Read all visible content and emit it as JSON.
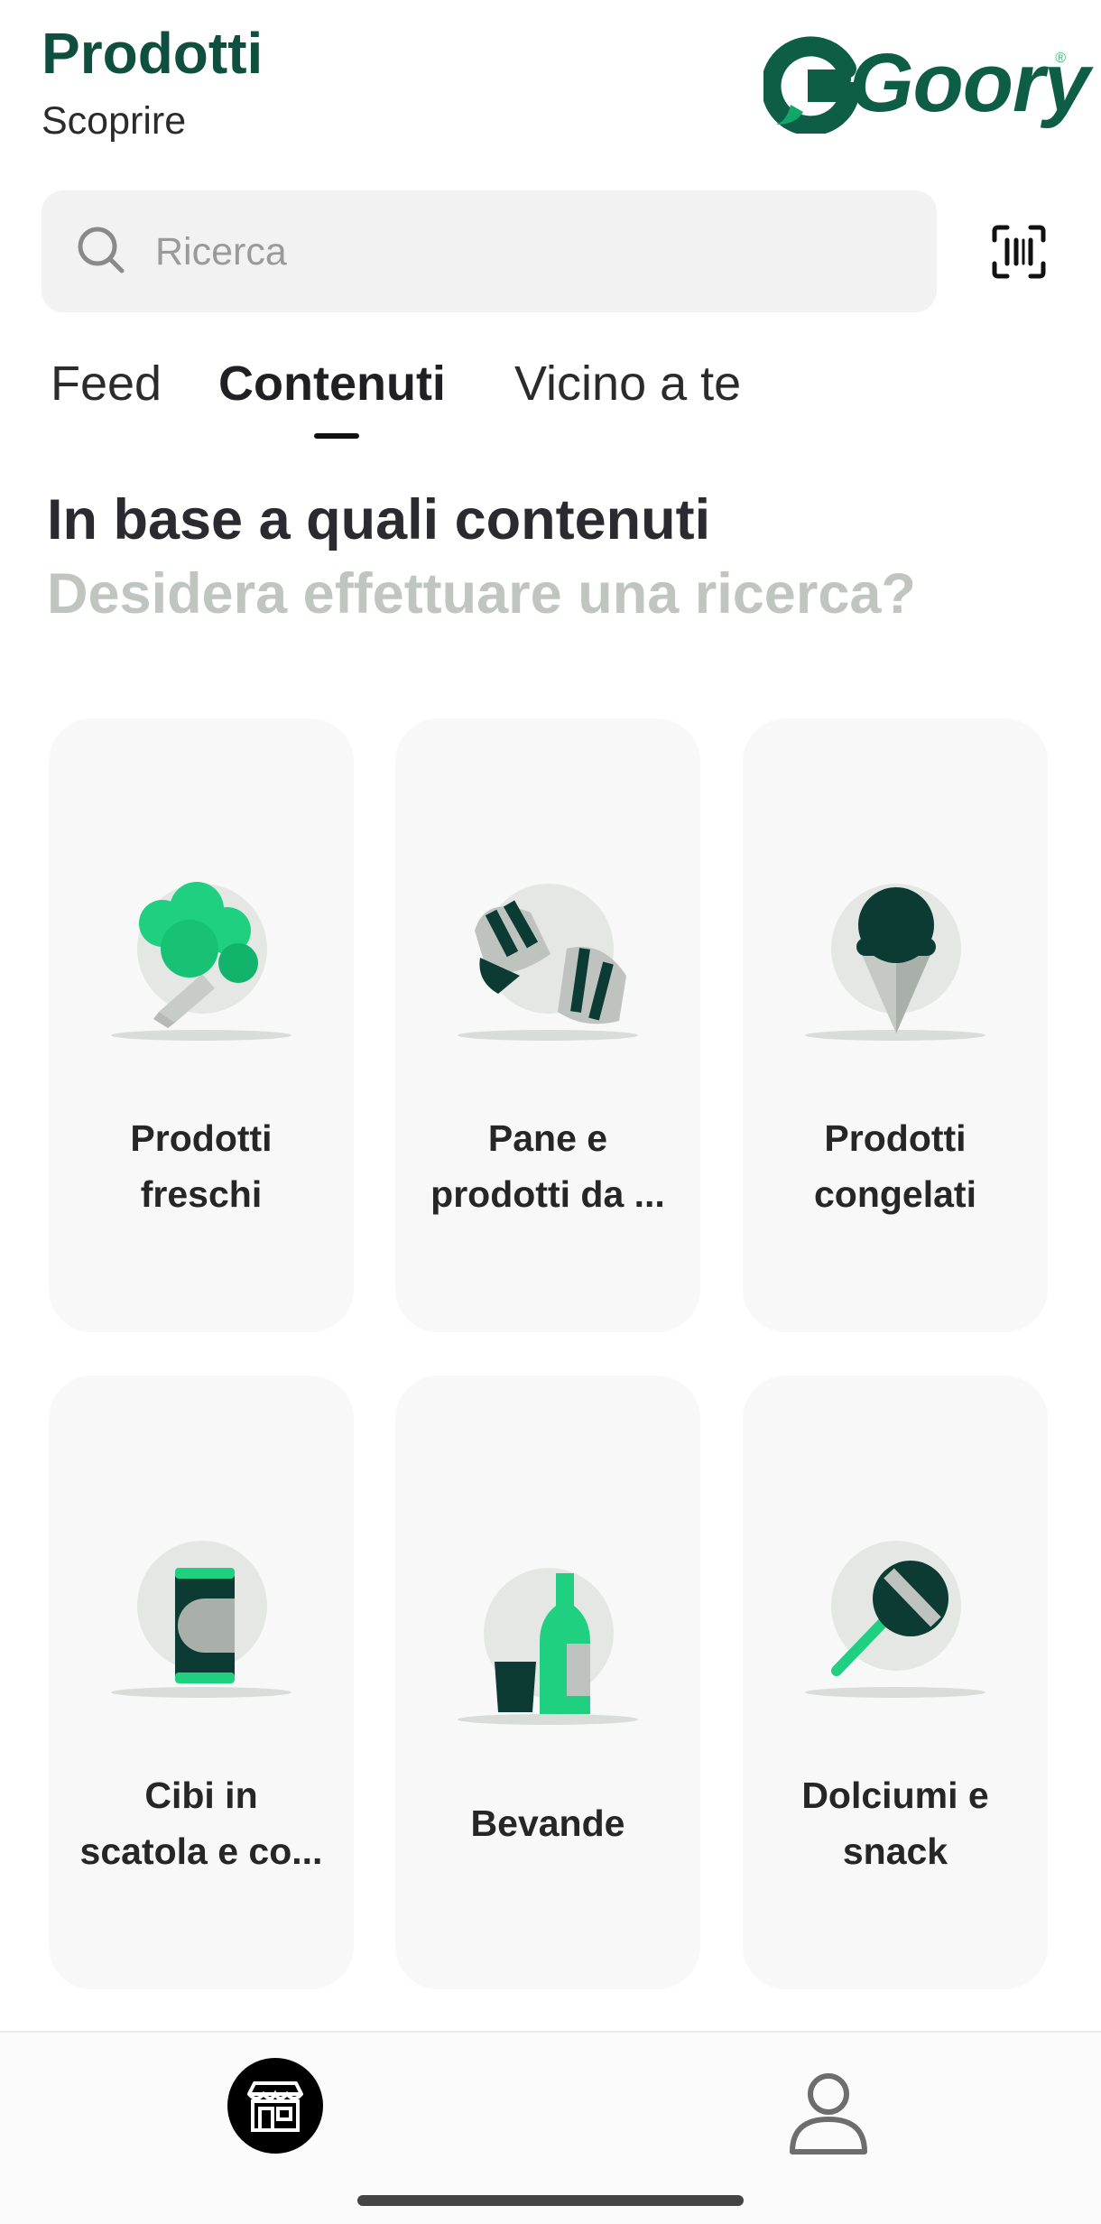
{
  "header": {
    "title": "Prodotti",
    "subtitle": "Scoprire",
    "logo_text": "Goory"
  },
  "search": {
    "placeholder": "Ricerca",
    "value": "",
    "icon": "search-icon",
    "scan_icon": "barcode-scan-icon"
  },
  "tabs": [
    {
      "label": "Feed",
      "active": false
    },
    {
      "label": "Contenuti",
      "active": true
    },
    {
      "label": "Vicino a te",
      "active": false
    }
  ],
  "heading": {
    "line1": "In base a quali contenuti",
    "line2": "Desidera effettuare una ricerca?"
  },
  "categories": [
    {
      "label_line1": "Prodotti",
      "label_line2": "freschi",
      "icon": "broccoli-icon"
    },
    {
      "label_line1": "Pane e",
      "label_line2": "prodotti da ...",
      "icon": "croissant-icon"
    },
    {
      "label_line1": "Prodotti",
      "label_line2": "congelati",
      "icon": "ice-cream-icon"
    },
    {
      "label_line1": "Cibi in",
      "label_line2": "scatola e co...",
      "icon": "can-icon"
    },
    {
      "label_line1": "Bevande",
      "label_line2": "",
      "icon": "drinks-icon"
    },
    {
      "label_line1": "Dolciumi e",
      "label_line2": "snack",
      "icon": "lollipop-icon"
    }
  ],
  "bottom_nav": [
    {
      "icon": "store-icon",
      "active": true
    },
    {
      "icon": "user-icon",
      "active": false
    }
  ],
  "colors": {
    "brand": "#0f4f3f",
    "accent": "#1ed07f",
    "dark_green": "#0b3b33"
  }
}
